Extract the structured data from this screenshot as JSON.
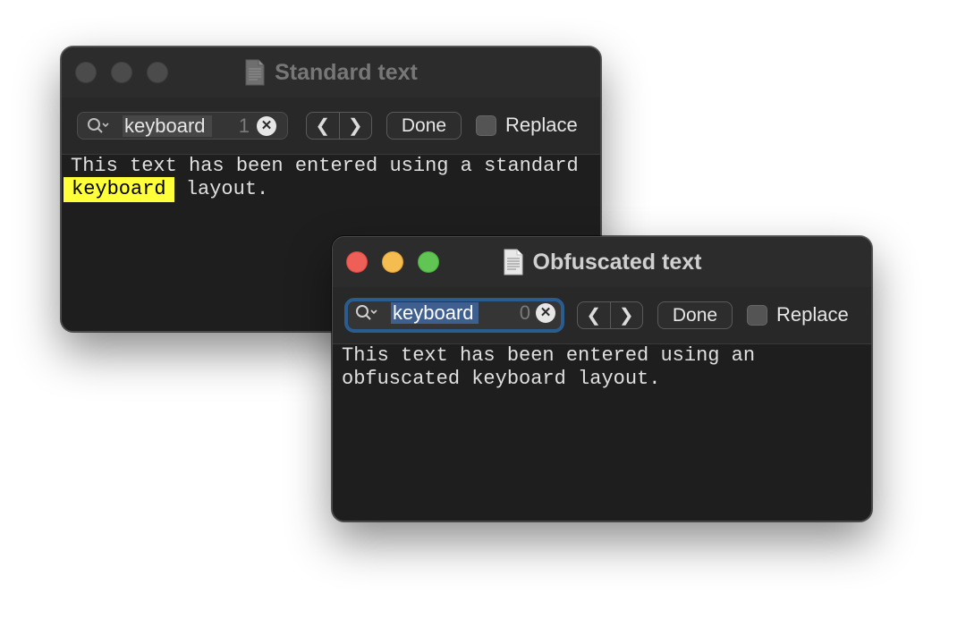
{
  "windows": [
    {
      "title": "Standard text",
      "find": {
        "query": "keyboard",
        "match_count": "1",
        "prev_glyph": "❮",
        "next_glyph": "❯",
        "done_label": "Done",
        "replace_label": "Replace"
      },
      "content": {
        "line1": "This text has been entered using a standard",
        "line2_highlight": "keyboard",
        "line2_rest": " layout."
      }
    },
    {
      "title": "Obfuscated text",
      "find": {
        "query": "keyboard",
        "match_count": "0",
        "prev_glyph": "❮",
        "next_glyph": "❯",
        "done_label": "Done",
        "replace_label": "Replace"
      },
      "content": {
        "line1": "This text has been entered using an",
        "line2": "obfuscated keyboard layout."
      }
    }
  ],
  "icons": {
    "search": "magnifier-with-chevron",
    "clear": "x-circle",
    "document": "document-icon"
  },
  "colors": {
    "highlight": "#ffff3a",
    "focus_ring": "#2b5c8f",
    "selection": "#3f5f8e",
    "traffic_close": "#ee5f57",
    "traffic_minimize": "#f5bd4f",
    "traffic_maximize": "#61c554"
  }
}
